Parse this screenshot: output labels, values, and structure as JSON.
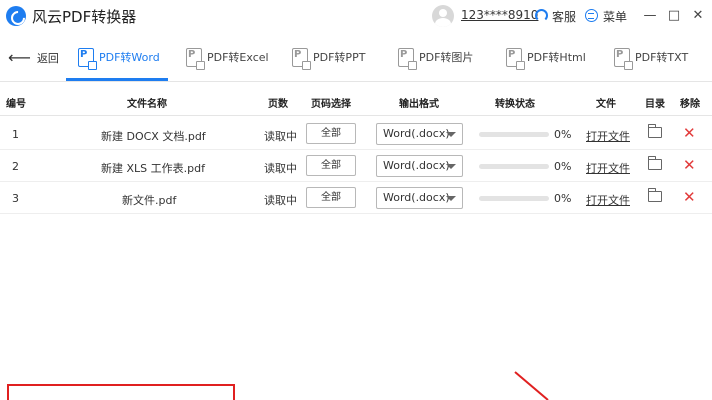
{
  "window": {
    "title": "风云PDF转换器",
    "user_phone": "123****8910",
    "service_label": "客服",
    "menu_label": "菜单",
    "minimize_glyph": "—",
    "maximize_glyph": "□",
    "close_glyph": "✕"
  },
  "toolbar": {
    "back_label": "返回",
    "tabs": [
      {
        "label": "PDF转Word",
        "active": true
      },
      {
        "label": "PDF转Excel",
        "active": false
      },
      {
        "label": "PDF转PPT",
        "active": false
      },
      {
        "label": "PDF转图片",
        "active": false
      },
      {
        "label": "PDF转Html",
        "active": false
      },
      {
        "label": "PDF转TXT",
        "active": false
      }
    ]
  },
  "table": {
    "headers": {
      "index": "编号",
      "filename": "文件名称",
      "pages": "页数",
      "page_select": "页码选择",
      "output_format": "输出格式",
      "status": "转换状态",
      "file": "文件",
      "directory": "目录",
      "remove": "移除"
    },
    "rows": [
      {
        "index": "1",
        "filename": "新建 DOCX 文档.pdf",
        "pages": "读取中",
        "page_select": "全部",
        "format": "Word(.docx)",
        "progress": 0,
        "progress_text": "0%",
        "open_file": "打开文件"
      },
      {
        "index": "2",
        "filename": "新建 XLS 工作表.pdf",
        "pages": "读取中",
        "page_select": "全部",
        "format": "Word(.docx)",
        "progress": 0,
        "progress_text": "0%",
        "open_file": "打开文件"
      },
      {
        "index": "3",
        "filename": "新文件.pdf",
        "pages": "读取中",
        "page_select": "全部",
        "format": "Word(.docx)",
        "progress": 0,
        "progress_text": "0%",
        "open_file": "打开文件"
      }
    ]
  },
  "colors": {
    "accent": "#1e7df0",
    "remove": "#e23b3b",
    "annotation": "#e02020"
  },
  "icons": {
    "back": "arrow-left-icon",
    "folder": "folder-icon",
    "remove": "close-icon",
    "service": "headset-icon",
    "menu": "menu-icon"
  }
}
